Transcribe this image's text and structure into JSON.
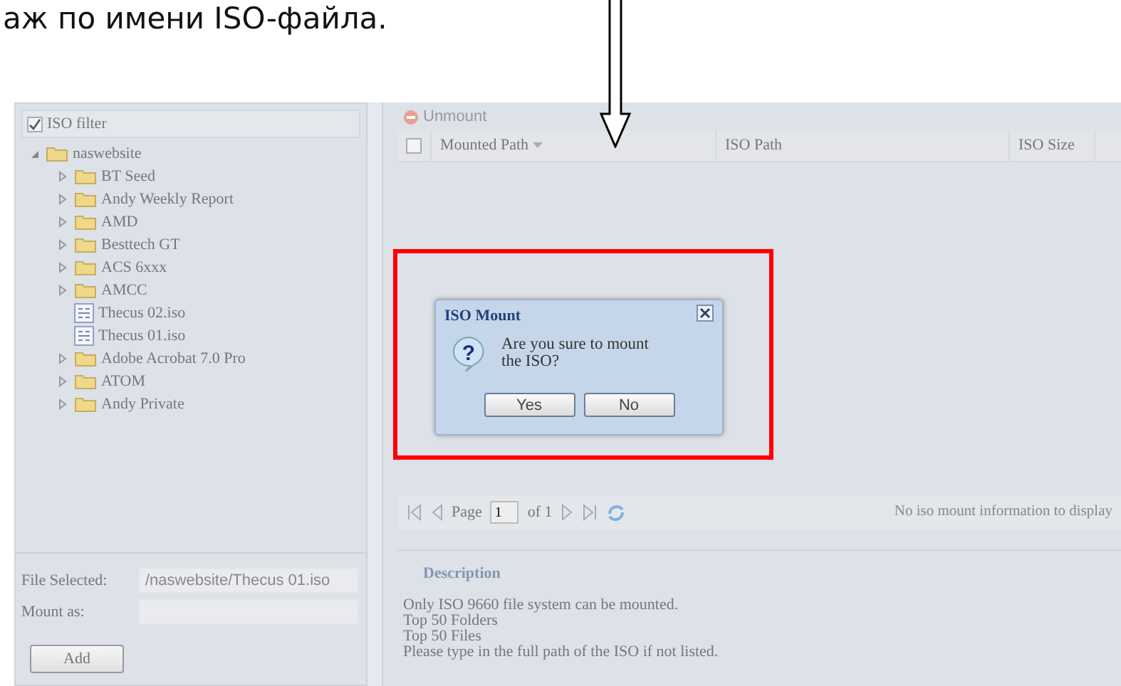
{
  "caption": "аж по имени ISO-файла.",
  "filter": {
    "label": "ISO filter",
    "checked": true
  },
  "tree": [
    {
      "label": "naswebsite",
      "kind": "folder",
      "expanded": true,
      "children": [
        {
          "label": "BT Seed",
          "kind": "folder",
          "expanded": false
        },
        {
          "label": "Andy Weekly Report",
          "kind": "folder",
          "expanded": false
        },
        {
          "label": "AMD",
          "kind": "folder",
          "expanded": false
        },
        {
          "label": "Besttech GT",
          "kind": "folder",
          "expanded": false
        },
        {
          "label": "ACS 6xxx",
          "kind": "folder",
          "expanded": false
        },
        {
          "label": "AMCC",
          "kind": "folder",
          "expanded": false
        },
        {
          "label": "Thecus 02.iso",
          "kind": "file"
        },
        {
          "label": "Thecus 01.iso",
          "kind": "file"
        },
        {
          "label": "Adobe Acrobat 7.0 Pro",
          "kind": "folder",
          "expanded": false
        },
        {
          "label": "ATOM",
          "kind": "folder",
          "expanded": false
        },
        {
          "label": "Andy Private",
          "kind": "folder",
          "expanded": false
        }
      ]
    }
  ],
  "form": [
    {
      "label": "File Selected:",
      "value": "/naswebsite/Thecus 01.iso"
    },
    {
      "label": "Mount as:"
    }
  ],
  "add_button": "Add",
  "toolbar": {
    "unmount": "Unmount"
  },
  "table": {
    "select_all": {
      "checked": false
    },
    "columns": [
      "Mounted Path",
      "ISO Path",
      "ISO Size"
    ]
  },
  "pager": {
    "page_label": "Page",
    "page": "1",
    "of": "of 1",
    "status": "No iso mount information to display"
  },
  "description": {
    "title": "Description",
    "lines": [
      "Only ISO 9660 file system can be mounted.",
      "Top 50 Folders",
      "Top 50 Files",
      "Please type in the full path of the ISO if not listed."
    ]
  },
  "dialog": {
    "title": "ISO Mount",
    "icon_glyph": "?",
    "message": "Are you sure to mount the ISO?",
    "buttons": [
      "Yes",
      "No"
    ]
  }
}
